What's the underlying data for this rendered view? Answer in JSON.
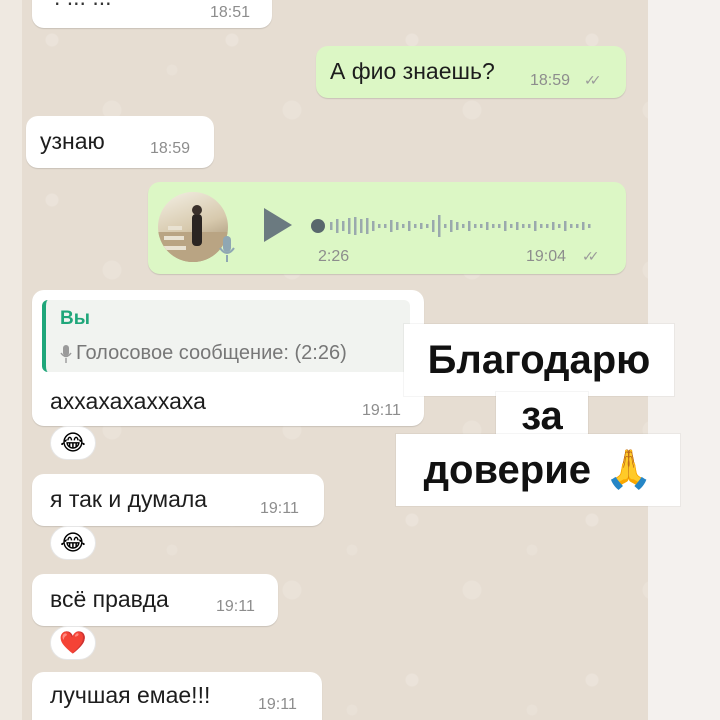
{
  "messages": {
    "top_partial": {
      "time": "18:51"
    },
    "m1": {
      "text": "А фио знаешь?",
      "time": "18:59",
      "ticks": "✓✓"
    },
    "m2": {
      "text": "узнаю",
      "time": "18:59"
    },
    "voice": {
      "duration": "2:26",
      "time": "19:04",
      "ticks": "✓✓"
    },
    "reply": {
      "quote_author": "Вы",
      "quote_text": "Голосовое сообщение: (2:26)",
      "text": "аххахахаххаха",
      "time": "19:11",
      "reaction": "😂"
    },
    "m4": {
      "text": "я так и думала",
      "time": "19:11",
      "reaction": "😂"
    },
    "m5": {
      "text": "всё правда",
      "time": "19:11",
      "reaction": "❤️"
    },
    "m6": {
      "text": "лучшая емае!!!",
      "time": "19:11"
    }
  },
  "overlay": {
    "line1": "Благодарю",
    "line2": "за",
    "line3": "доверие",
    "emoji": "🙏"
  },
  "colors": {
    "outgoing": "#dcf7c5",
    "incoming": "#ffffff",
    "quote_accent": "#1fa67a",
    "chat_background": "#e6ddd2"
  },
  "icons": [
    "play-icon",
    "mic-icon",
    "double-check-icon"
  ]
}
